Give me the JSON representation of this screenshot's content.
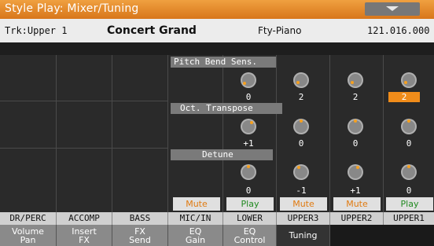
{
  "title": "Style Play: Mixer/Tuning",
  "info": {
    "track": "Trk:Upper 1",
    "sound": "Concert Grand",
    "category": "Fty-Piano",
    "program": "121.016.000"
  },
  "sections": {
    "pitch_bend": "Pitch Bend Sens.",
    "octave": "Oct. Transpose",
    "detune": "Detune"
  },
  "values": {
    "pitch_bend": [
      "0",
      "2",
      "2",
      "2"
    ],
    "octave": [
      "+1",
      "0",
      "0",
      "0"
    ],
    "detune": [
      "0",
      "-1",
      "+1",
      "0"
    ]
  },
  "play_buttons": [
    "Mute",
    "Play",
    "Mute",
    "Mute",
    "Play"
  ],
  "channels": [
    "DR/PERC",
    "ACCOMP",
    "BASS",
    "MIC/IN",
    "LOWER",
    "UPPER3",
    "UPPER2",
    "UPPER1"
  ],
  "tabs": [
    {
      "l1": "Volume",
      "l2": "Pan"
    },
    {
      "l1": "Insert",
      "l2": "FX"
    },
    {
      "l1": "FX",
      "l2": "Send"
    },
    {
      "l1": "EQ",
      "l2": "Gain"
    },
    {
      "l1": "EQ",
      "l2": "Control"
    },
    {
      "l1": "Tuning",
      "l2": ""
    }
  ],
  "colors": {
    "accent": "#f08c1a",
    "title_bar": "#e0801e",
    "knob_dot": "#f5a020",
    "play_text": "#208a20",
    "mute_text": "#e07a10"
  },
  "icons": {
    "menu": "chevron-down-icon",
    "knob": "knob-icon"
  }
}
